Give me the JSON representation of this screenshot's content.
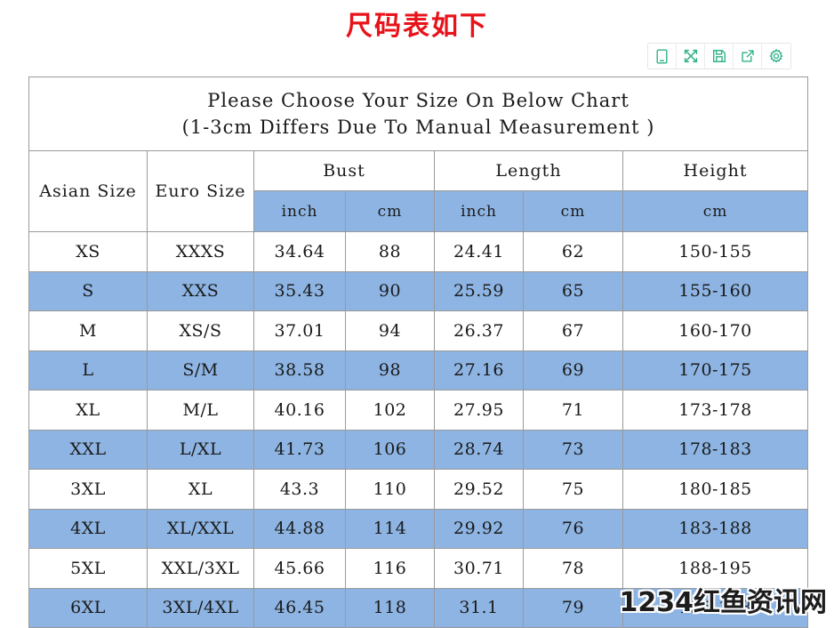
{
  "page": {
    "title": "尺码表如下",
    "title_color": "#e8131a",
    "background": "#ffffff",
    "watermark": "1234红鱼资讯网"
  },
  "toolbar": {
    "accent_color": "#2eb38a",
    "buttons": [
      {
        "icon": "mobile-preview-icon",
        "label": ""
      },
      {
        "icon": "fullscreen-expand-icon",
        "label": ""
      },
      {
        "icon": "save-floppy-icon",
        "label": ""
      },
      {
        "icon": "share-export-icon",
        "label": ""
      },
      {
        "icon": "settings-gear-icon",
        "label": ""
      }
    ]
  },
  "chart": {
    "caption_line1": "Please Choose Your Size On Below Chart",
    "caption_line2": "(1-3cm Differs Due To Manual Measurement )",
    "row_blue": "#8DB4E2",
    "row_white": "#ffffff",
    "border_color": "#9a9a9a",
    "headers": {
      "asian_size": "Asian Size",
      "euro_size": "Euro Size",
      "bust": "Bust",
      "length": "Length",
      "height": "Height",
      "bust_inch": "inch",
      "bust_cm": "cm",
      "length_inch": "inch",
      "length_cm": "cm",
      "height_cm": "cm"
    },
    "rows": [
      {
        "asian": "XS",
        "euro": "XXXS",
        "bust_inch": "34.64",
        "bust_cm": "88",
        "length_inch": "24.41",
        "length_cm": "62",
        "height": "150-155",
        "shade": "white"
      },
      {
        "asian": "S",
        "euro": "XXS",
        "bust_inch": "35.43",
        "bust_cm": "90",
        "length_inch": "25.59",
        "length_cm": "65",
        "height": "155-160",
        "shade": "blue"
      },
      {
        "asian": "M",
        "euro": "XS/S",
        "bust_inch": "37.01",
        "bust_cm": "94",
        "length_inch": "26.37",
        "length_cm": "67",
        "height": "160-170",
        "shade": "white"
      },
      {
        "asian": "L",
        "euro": "S/M",
        "bust_inch": "38.58",
        "bust_cm": "98",
        "length_inch": "27.16",
        "length_cm": "69",
        "height": "170-175",
        "shade": "blue"
      },
      {
        "asian": "XL",
        "euro": "M/L",
        "bust_inch": "40.16",
        "bust_cm": "102",
        "length_inch": "27.95",
        "length_cm": "71",
        "height": "173-178",
        "shade": "white"
      },
      {
        "asian": "XXL",
        "euro": "L/XL",
        "bust_inch": "41.73",
        "bust_cm": "106",
        "length_inch": "28.74",
        "length_cm": "73",
        "height": "178-183",
        "shade": "blue"
      },
      {
        "asian": "3XL",
        "euro": "XL",
        "bust_inch": "43.3",
        "bust_cm": "110",
        "length_inch": "29.52",
        "length_cm": "75",
        "height": "180-185",
        "shade": "white"
      },
      {
        "asian": "4XL",
        "euro": "XL/XXL",
        "bust_inch": "44.88",
        "bust_cm": "114",
        "length_inch": "29.92",
        "length_cm": "76",
        "height": "183-188",
        "shade": "blue"
      },
      {
        "asian": "5XL",
        "euro": "XXL/3XL",
        "bust_inch": "45.66",
        "bust_cm": "116",
        "length_inch": "30.71",
        "length_cm": "78",
        "height": "188-195",
        "shade": "white"
      },
      {
        "asian": "6XL",
        "euro": "3XL/4XL",
        "bust_inch": "46.45",
        "bust_cm": "118",
        "length_inch": "31.1",
        "length_cm": "79",
        "height": "195-198",
        "shade": "blue"
      }
    ]
  }
}
